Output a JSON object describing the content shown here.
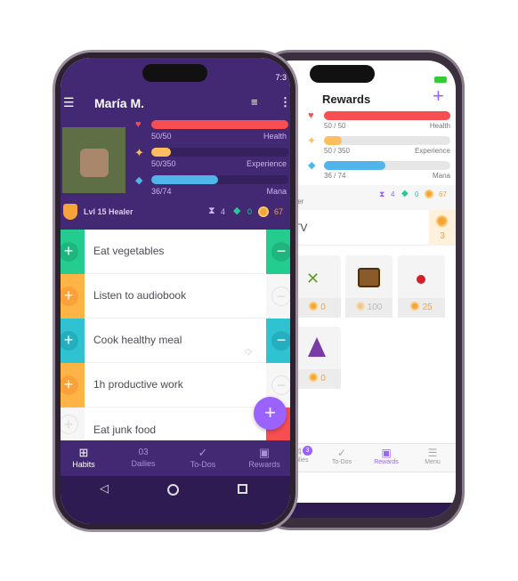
{
  "colors": {
    "purple": "#432874",
    "health": "#f74e52",
    "experience": "#ffbe5d",
    "mana": "#50b5e9",
    "green": "#24cc8f",
    "orange": "#ffb445",
    "teal": "#2fc3d2",
    "red": "#f74e52",
    "accent": "#9a62ff"
  },
  "android": {
    "status_time": "7:3",
    "user_name": "María M.",
    "stats": {
      "health": {
        "value": "50/50",
        "label": "Health",
        "fraction": 1.0
      },
      "experience": {
        "value": "50/350",
        "label": "Experience",
        "fraction": 0.143
      },
      "mana": {
        "value": "36/74",
        "label": "Mana",
        "fraction": 0.486
      }
    },
    "level": "Lvl 15 Healer",
    "hourglasses": "4",
    "gems": "0",
    "gold": "67",
    "habits": [
      {
        "title": "Eat vegetables"
      },
      {
        "title": "Listen to audiobook"
      },
      {
        "title": "Cook healthy meal"
      },
      {
        "title": "1h productive work"
      },
      {
        "title": "Eat junk food"
      }
    ],
    "nav": [
      "Habits",
      "Dailies",
      "To-Dos",
      "Rewards"
    ],
    "dailies_icon_number": "03"
  },
  "ios": {
    "title": "Rewards",
    "stats": {
      "health": {
        "value": "50 / 50",
        "label": "Health",
        "fraction": 1.0
      },
      "experience": {
        "value": "50 / 350",
        "label": "Experience",
        "fraction": 0.143
      },
      "mana": {
        "value": "36 / 74",
        "label": "Mana",
        "fraction": 0.486
      }
    },
    "level_partial": "aler",
    "hourglasses": "4",
    "gems": "0",
    "gold": "67",
    "custom_reward": {
      "title": "TV",
      "price": "3"
    },
    "items": [
      {
        "icon": "armor-icon",
        "price": "0"
      },
      {
        "icon": "treasure-chest-icon",
        "price": "100"
      },
      {
        "icon": "health-potion-icon",
        "price": "25"
      },
      {
        "icon": "party-hat-icon",
        "price": "0"
      }
    ],
    "nav": [
      "Dailies",
      "To-Dos",
      "Rewards",
      "Menu"
    ],
    "dailies_badge": "3",
    "dailies_icon_number": "4"
  }
}
